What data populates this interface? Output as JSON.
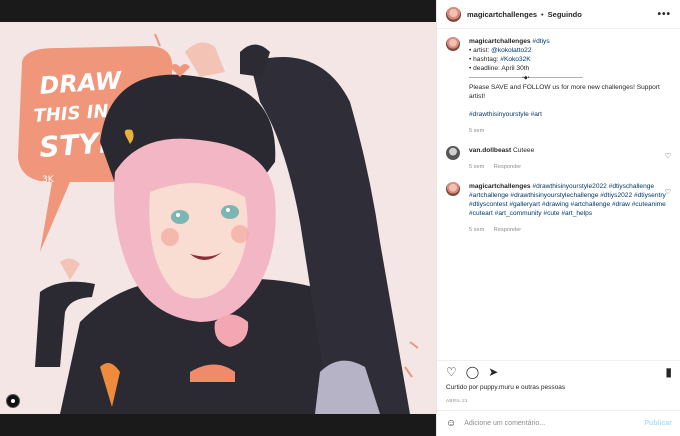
{
  "post": {
    "image_alt": "Artwork: pink-haired character in beanie making a heart with hands",
    "art_text": [
      "DRAW",
      "THIS IN YOUR",
      "STYLE!"
    ],
    "art_subtext": "3K"
  },
  "header": {
    "username": "magicartchallenges",
    "separator": "•",
    "follow_label": "Seguindo",
    "more_label": "•••"
  },
  "caption": {
    "username": "magicartchallenges",
    "hashtag_inline": "#dtiys",
    "lines": [
      "• artist: ",
      "• hashtag: ",
      "• deadline: April 30th"
    ],
    "artist_handle": "@kokolatto22",
    "artist_hashtag": "#Koko32K",
    "divider": "───────────────•◆•───────────────",
    "paragraph": "Please SAVE and FOLLOW us for more new challenges! Support artist!",
    "tags": "#drawthisinyourstyle #art",
    "time": "5 sem"
  },
  "comment1": {
    "username": "van.dollbeast",
    "text": " Cuteee",
    "time": "5 sem",
    "reply": "Responder"
  },
  "comment2": {
    "username": "magicartchallenges",
    "text": " #drawthisinyourstyle2022 #dtiyschallenge #artchallenge #drawthisinyourstylechallenge #dtiys2022 #dtiysentry #dtiyscontest #galleryart #drawing #artchallenge #draw #cuteanime #cuteart #art_community #cute #art_helps",
    "time": "5 sem",
    "reply": "Responder"
  },
  "actions": {
    "like_icon": "heart-icon",
    "comment_icon": "comment-icon",
    "share_icon": "share-icon",
    "save_icon": "bookmark-icon"
  },
  "likes_text": "Curtido por puppy.muru e outras pessoas",
  "date_text": "ABRIL 21",
  "add_comment": {
    "placeholder": "Adicione um comentário...",
    "publish_label": "Publicar"
  }
}
